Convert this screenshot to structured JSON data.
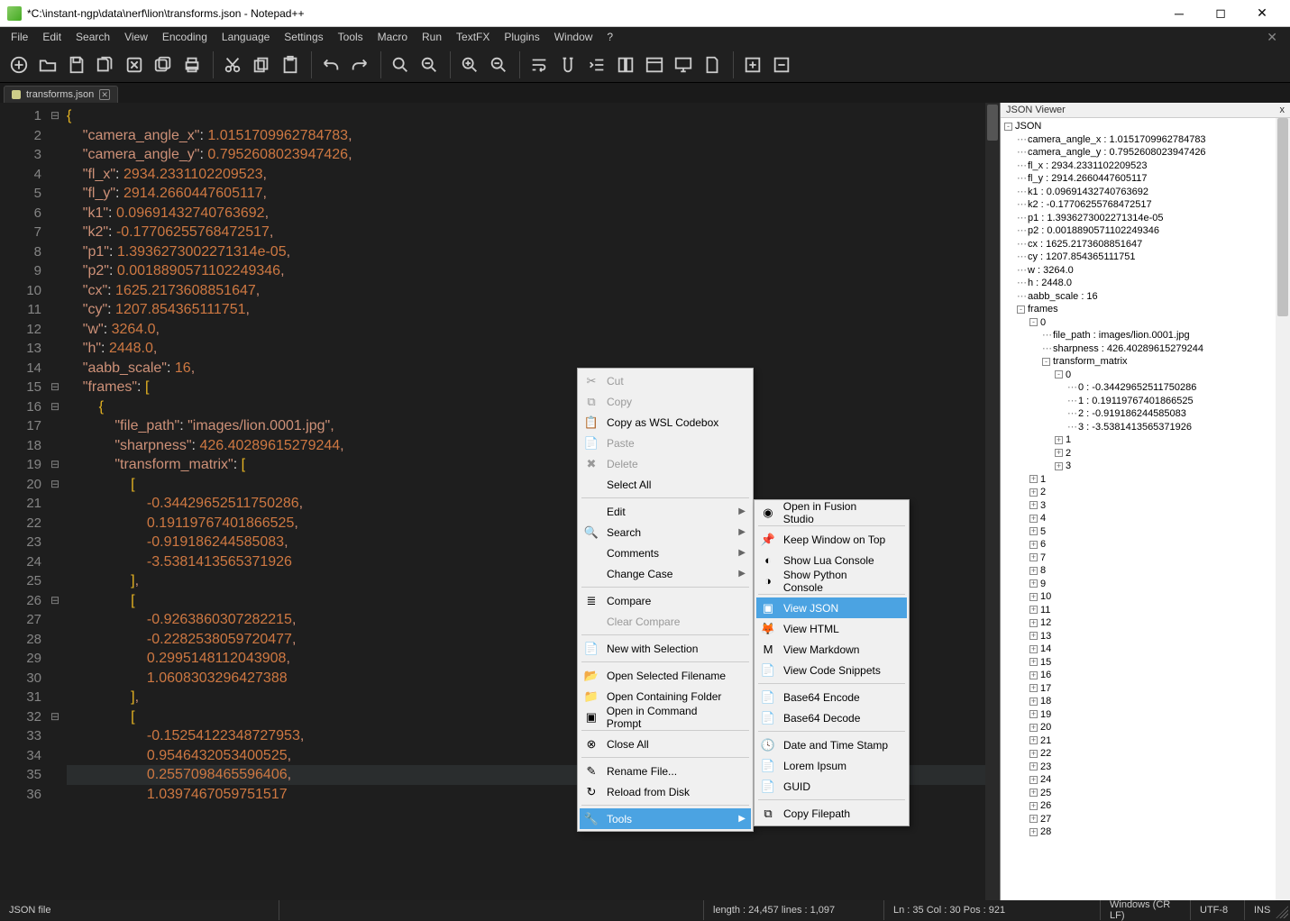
{
  "window": {
    "title": "*C:\\instant-ngp\\data\\nerf\\lion\\transforms.json - Notepad++"
  },
  "menus": [
    "File",
    "Edit",
    "Search",
    "View",
    "Encoding",
    "Language",
    "Settings",
    "Tools",
    "Macro",
    "Run",
    "TextFX",
    "Plugins",
    "Window",
    "?"
  ],
  "tab": {
    "name": "transforms.json"
  },
  "code_lines": [
    {
      "n": 1,
      "fold": "⊟",
      "html": "<span class='tok-brace'>{</span>"
    },
    {
      "n": 2,
      "html": "    <span class='tok-key'>\"camera_angle_x\"</span><span class='tok-colon'>:</span> <span class='tok-num'>1.0151709962784783</span><span class='tok-punc'>,</span>"
    },
    {
      "n": 3,
      "html": "    <span class='tok-key'>\"camera_angle_y\"</span><span class='tok-colon'>:</span> <span class='tok-num'>0.7952608023947426</span><span class='tok-punc'>,</span>"
    },
    {
      "n": 4,
      "html": "    <span class='tok-key'>\"fl_x\"</span><span class='tok-colon'>:</span> <span class='tok-num'>2934.2331102209523</span><span class='tok-punc'>,</span>"
    },
    {
      "n": 5,
      "html": "    <span class='tok-key'>\"fl_y\"</span><span class='tok-colon'>:</span> <span class='tok-num'>2914.2660447605117</span><span class='tok-punc'>,</span>"
    },
    {
      "n": 6,
      "html": "    <span class='tok-key'>\"k1\"</span><span class='tok-colon'>:</span> <span class='tok-num'>0.09691432740763692</span><span class='tok-punc'>,</span>"
    },
    {
      "n": 7,
      "html": "    <span class='tok-key'>\"k2\"</span><span class='tok-colon'>:</span> <span class='tok-num'>-0.17706255768472517</span><span class='tok-punc'>,</span>"
    },
    {
      "n": 8,
      "html": "    <span class='tok-key'>\"p1\"</span><span class='tok-colon'>:</span> <span class='tok-num'>1.3936273002271314e-05</span><span class='tok-punc'>,</span>"
    },
    {
      "n": 9,
      "html": "    <span class='tok-key'>\"p2\"</span><span class='tok-colon'>:</span> <span class='tok-num'>0.0018890571102249346</span><span class='tok-punc'>,</span>"
    },
    {
      "n": 10,
      "html": "    <span class='tok-key'>\"cx\"</span><span class='tok-colon'>:</span> <span class='tok-num'>1625.2173608851647</span><span class='tok-punc'>,</span>"
    },
    {
      "n": 11,
      "html": "    <span class='tok-key'>\"cy\"</span><span class='tok-colon'>:</span> <span class='tok-num'>1207.854365111751</span><span class='tok-punc'>,</span>"
    },
    {
      "n": 12,
      "html": "    <span class='tok-key'>\"w\"</span><span class='tok-colon'>:</span> <span class='tok-num'>3264.0</span><span class='tok-punc'>,</span>"
    },
    {
      "n": 13,
      "html": "    <span class='tok-key'>\"h\"</span><span class='tok-colon'>:</span> <span class='tok-num'>2448.0</span><span class='tok-punc'>,</span>"
    },
    {
      "n": 14,
      "html": "    <span class='tok-key'>\"aabb_scale\"</span><span class='tok-colon'>:</span> <span class='tok-num'>16</span><span class='tok-punc'>,</span>"
    },
    {
      "n": 15,
      "fold": "⊟",
      "html": "    <span class='tok-key'>\"frames\"</span><span class='tok-colon'>:</span> <span class='tok-brace'>[</span>"
    },
    {
      "n": 16,
      "fold": "⊟",
      "html": "        <span class='tok-brace'>{</span>"
    },
    {
      "n": 17,
      "html": "            <span class='tok-key'>\"file_path\"</span><span class='tok-colon'>:</span> <span class='tok-str'>\"images/lion.0001.jpg\"</span><span class='tok-punc'>,</span>"
    },
    {
      "n": 18,
      "html": "            <span class='tok-key'>\"sharpness\"</span><span class='tok-colon'>:</span> <span class='tok-num'>426.40289615279244</span><span class='tok-punc'>,</span>"
    },
    {
      "n": 19,
      "fold": "⊟",
      "html": "            <span class='tok-key'>\"transform_matrix\"</span><span class='tok-colon'>:</span> <span class='tok-brace'>[</span>"
    },
    {
      "n": 20,
      "fold": "⊟",
      "html": "                <span class='tok-brace'>[</span>"
    },
    {
      "n": 21,
      "html": "                    <span class='tok-num'>-0.34429652511750286</span><span class='tok-punc'>,</span>"
    },
    {
      "n": 22,
      "html": "                    <span class='tok-num'>0.19119767401866525</span><span class='tok-punc'>,</span>"
    },
    {
      "n": 23,
      "html": "                    <span class='tok-num'>-0.919186244585083</span><span class='tok-punc'>,</span>"
    },
    {
      "n": 24,
      "html": "                    <span class='tok-num'>-3.5381413565371926</span>"
    },
    {
      "n": 25,
      "html": "                <span class='tok-brace'>]</span><span class='tok-punc'>,</span>"
    },
    {
      "n": 26,
      "fold": "⊟",
      "html": "                <span class='tok-brace'>[</span>"
    },
    {
      "n": 27,
      "html": "                    <span class='tok-num'>-0.9263860307282215</span><span class='tok-punc'>,</span>"
    },
    {
      "n": 28,
      "html": "                    <span class='tok-num'>-0.2282538059720477</span><span class='tok-punc'>,</span>"
    },
    {
      "n": 29,
      "html": "                    <span class='tok-num'>0.2995148112043908</span><span class='tok-punc'>,</span>"
    },
    {
      "n": 30,
      "html": "                    <span class='tok-num'>1.0608303296427388</span>"
    },
    {
      "n": 31,
      "html": "                <span class='tok-brace'>]</span><span class='tok-punc'>,</span>"
    },
    {
      "n": 32,
      "fold": "⊟",
      "html": "                <span class='tok-brace'>[</span>"
    },
    {
      "n": 33,
      "html": "                    <span class='tok-num'>-0.15254122348727953</span><span class='tok-punc'>,</span>"
    },
    {
      "n": 34,
      "html": "                    <span class='tok-num'>0.9546432053400525</span><span class='tok-punc'>,</span>"
    },
    {
      "n": 35,
      "hl": true,
      "html": "                    <span class='tok-num'>0.2557098465596406</span><span class='tok-punc'>,</span>"
    },
    {
      "n": 36,
      "html": "                    <span class='tok-num'>1.0397467059751517</span>"
    }
  ],
  "json_viewer": {
    "title": "JSON Viewer",
    "root": "JSON",
    "props": [
      "camera_angle_x : 1.0151709962784783",
      "camera_angle_y : 0.7952608023947426",
      "fl_x : 2934.2331102209523",
      "fl_y : 2914.2660447605117",
      "k1 : 0.09691432740763692",
      "k2 : -0.17706255768472517",
      "p1 : 1.3936273002271314e-05",
      "p2 : 0.0018890571102249346",
      "cx : 1625.2173608851647",
      "cy : 1207.854365111751",
      "w : 3264.0",
      "h : 2448.0",
      "aabb_scale : 16"
    ],
    "frames_label": "frames",
    "frame0": {
      "label": "0",
      "file_path": "file_path : images/lion.0001.jpg",
      "sharpness": "sharpness : 426.40289615279244",
      "tm_label": "transform_matrix",
      "row0": {
        "label": "0",
        "vals": [
          "0 : -0.34429652511750286",
          "1 : 0.19119767401866525",
          "2 : -0.919186244585083",
          "3 : -3.5381413565371926"
        ]
      },
      "rows_rest": [
        "1",
        "2",
        "3"
      ]
    },
    "frames_rest": [
      1,
      2,
      3,
      4,
      5,
      6,
      7,
      8,
      9,
      10,
      11,
      12,
      13,
      14,
      15,
      16,
      17,
      18,
      19,
      20,
      21,
      22,
      23,
      24,
      25,
      26,
      27,
      28
    ]
  },
  "context_menu1": {
    "items": [
      {
        "label": "Cut",
        "disabled": true,
        "ic": "✂"
      },
      {
        "label": "Copy",
        "disabled": true,
        "ic": "⧉"
      },
      {
        "label": "Copy as WSL Codebox",
        "ic": "📋"
      },
      {
        "label": "Paste",
        "disabled": true,
        "ic": "📄"
      },
      {
        "label": "Delete",
        "disabled": true,
        "ic": "✖"
      },
      {
        "label": "Select All"
      },
      {
        "sep": true
      },
      {
        "label": "Edit",
        "arrow": true
      },
      {
        "label": "Search",
        "arrow": true,
        "ic": "🔍"
      },
      {
        "label": "Comments",
        "arrow": true
      },
      {
        "label": "Change Case",
        "arrow": true
      },
      {
        "sep": true
      },
      {
        "label": "Compare",
        "ic": "≣"
      },
      {
        "label": "Clear Compare",
        "disabled": true
      },
      {
        "sep": true
      },
      {
        "label": "New with Selection",
        "ic": "📄"
      },
      {
        "sep": true
      },
      {
        "label": "Open Selected Filename",
        "ic": "📂"
      },
      {
        "label": "Open Containing Folder",
        "ic": "📁"
      },
      {
        "label": "Open in Command Prompt",
        "ic": "▣"
      },
      {
        "sep": true
      },
      {
        "label": "Close All",
        "ic": "⊗"
      },
      {
        "sep": true
      },
      {
        "label": "Rename File...",
        "ic": "✎"
      },
      {
        "label": "Reload from Disk",
        "ic": "↻"
      },
      {
        "sep": true
      },
      {
        "label": "Tools",
        "arrow": true,
        "sel": true,
        "ic": "🔧"
      }
    ]
  },
  "context_menu2": {
    "items": [
      {
        "label": "Open in Fusion Studio",
        "ic": "◉"
      },
      {
        "sep": true
      },
      {
        "label": "Keep Window on Top",
        "ic": "📌"
      },
      {
        "label": "Show Lua Console",
        "ic": "◐"
      },
      {
        "label": "Show Python Console",
        "ic": "◑"
      },
      {
        "sep": true
      },
      {
        "label": "View JSON",
        "sel": true,
        "ic": "▣"
      },
      {
        "label": "View HTML",
        "ic": "🦊"
      },
      {
        "label": "View Markdown",
        "ic": "M"
      },
      {
        "label": "View Code Snippets",
        "ic": "📄"
      },
      {
        "sep": true
      },
      {
        "label": "Base64 Encode",
        "ic": "📄"
      },
      {
        "label": "Base64 Decode",
        "ic": "📄"
      },
      {
        "sep": true
      },
      {
        "label": "Date and Time Stamp",
        "ic": "🕓"
      },
      {
        "label": "Lorem Ipsum",
        "ic": "📄"
      },
      {
        "label": "GUID",
        "ic": "📄"
      },
      {
        "sep": true
      },
      {
        "label": "Copy Filepath",
        "ic": "⧉"
      }
    ]
  },
  "status": {
    "filetype": "JSON file",
    "length": "length : 24,457    lines : 1,097",
    "pos": "Ln : 35    Col : 30    Pos : 921",
    "eol": "Windows (CR LF)",
    "enc": "UTF-8",
    "ins": "INS"
  }
}
